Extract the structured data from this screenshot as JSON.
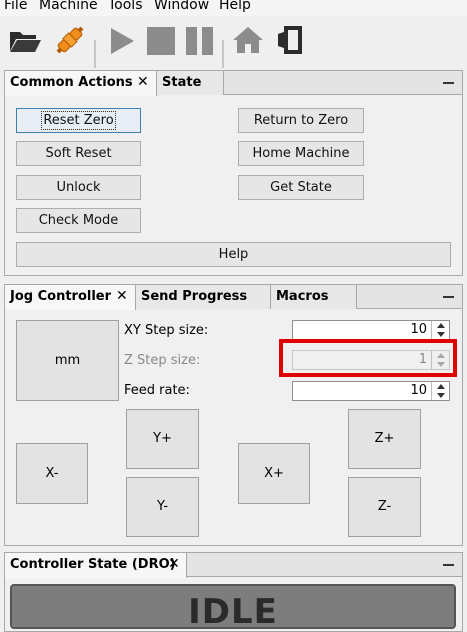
{
  "menubar": {
    "items": [
      "File",
      "Machine",
      "Tools",
      "Window",
      "Help"
    ]
  },
  "toolbar": {
    "icons": [
      "folder-open-icon",
      "connect-plug-icon",
      "play-icon",
      "stop-icon",
      "pause-icon",
      "home-icon",
      "terminal-icon"
    ]
  },
  "common_actions_panel": {
    "tabs": [
      "Common Actions",
      "State"
    ],
    "close_glyph": "✕",
    "buttons": {
      "reset_zero": "Reset Zero",
      "return_to_zero": "Return to Zero",
      "soft_reset": "Soft Reset",
      "home_machine": "Home Machine",
      "unlock": "Unlock",
      "get_state": "Get State",
      "check_mode": "Check Mode",
      "help": "Help"
    }
  },
  "jog_panel": {
    "tabs": [
      "Jog Controller",
      "Send Progress",
      "Macros"
    ],
    "close_glyph": "✕",
    "units_button": "mm",
    "xy_step_label": "XY Step size:",
    "xy_step_value": "10",
    "z_step_label": "Z Step size:",
    "z_step_value": "1",
    "feed_rate_label": "Feed rate:",
    "feed_rate_value": "10",
    "jog_buttons": {
      "y_plus": "Y+",
      "y_minus": "Y-",
      "x_minus": "X-",
      "x_plus": "X+",
      "z_plus": "Z+",
      "z_minus": "Z-"
    }
  },
  "dro_panel": {
    "tab": "Controller State (DRO)",
    "close_glyph": "✕",
    "state_text": "IDLE"
  },
  "colors": {
    "highlight": "#e00000",
    "dro_background": "#7d7d7d"
  }
}
